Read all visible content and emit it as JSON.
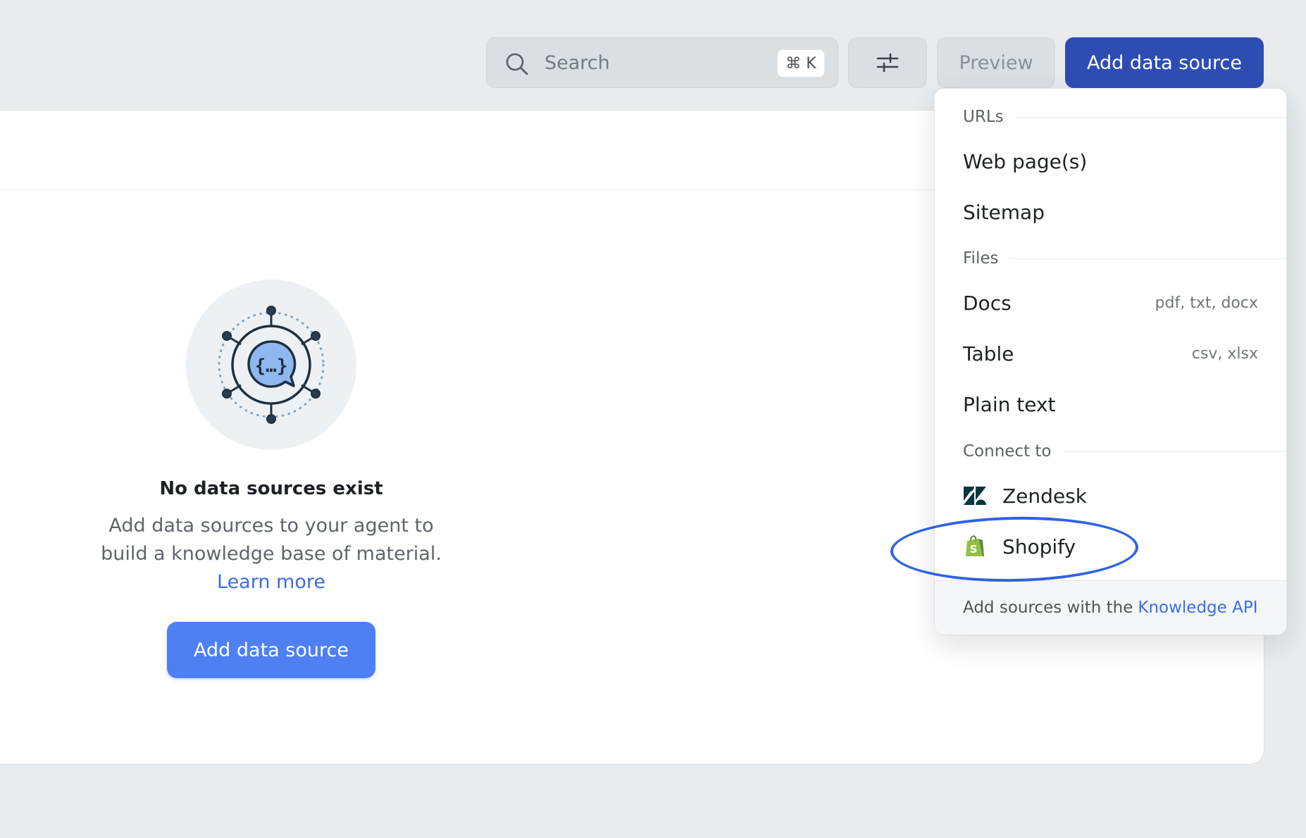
{
  "toolbar": {
    "search_label": "Search",
    "search_shortcut": "⌘ K",
    "preview_label": "Preview",
    "add_label": "Add data source"
  },
  "empty_state": {
    "title": "No data sources exist",
    "description": "Add data sources to your agent to build a knowledge base of material.",
    "learn_more": "Learn more",
    "button_label": "Add data source"
  },
  "dropdown": {
    "urls_heading": "URLs",
    "urls_items": [
      {
        "label": "Web page(s)"
      },
      {
        "label": "Sitemap"
      }
    ],
    "files_heading": "Files",
    "files_items": [
      {
        "label": "Docs",
        "meta": "pdf, txt, docx"
      },
      {
        "label": "Table",
        "meta": "csv, xlsx"
      },
      {
        "label": "Plain text"
      }
    ],
    "connect_heading": "Connect to",
    "connect_items": [
      {
        "label": "Zendesk",
        "icon": "zendesk-logo-icon"
      },
      {
        "label": "Shopify",
        "icon": "shopify-logo-icon"
      }
    ],
    "footer_text": "Add sources with the",
    "footer_link": "Knowledge API"
  },
  "colors": {
    "primary_dark": "#2e4db3",
    "primary": "#4e80f4",
    "link": "#3b6fe3",
    "highlight_ring": "#2f62e2",
    "shopify_green": "#95bf47",
    "zendesk_dark": "#03363d"
  }
}
